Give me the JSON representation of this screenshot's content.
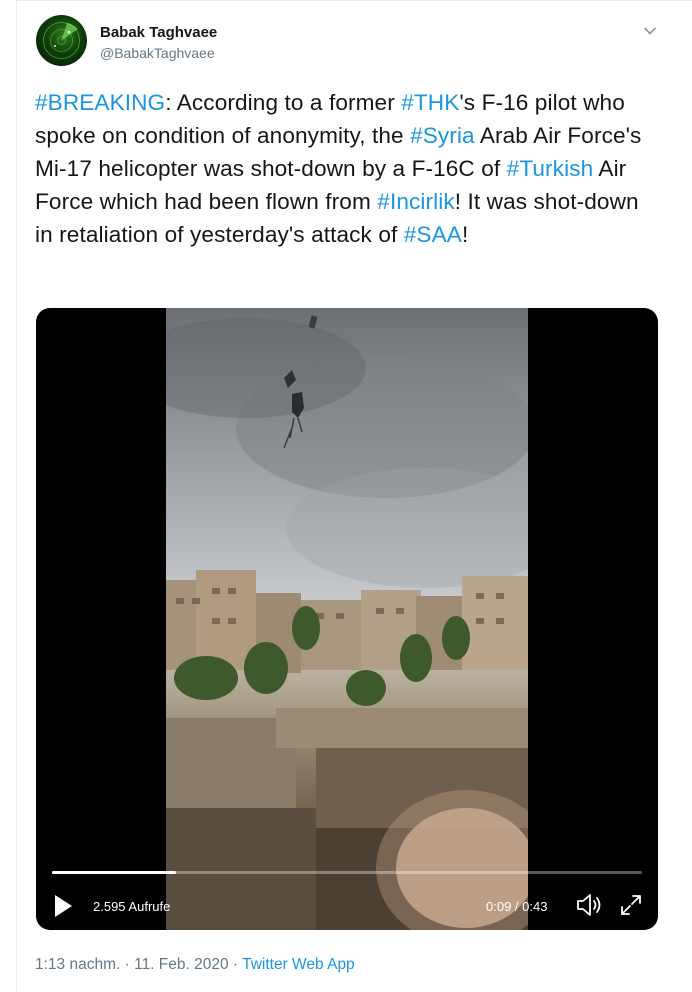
{
  "author": {
    "name": "Babak Taghvaee",
    "handle": "@BabakTaghvaee"
  },
  "tweet": {
    "segments": [
      {
        "text": "#BREAKING",
        "tag": true
      },
      {
        "text": ": According to a former ",
        "tag": false
      },
      {
        "text": "#THK",
        "tag": true
      },
      {
        "text": "'s F-16 pilot who spoke on condition of anonymity, the ",
        "tag": false
      },
      {
        "text": "#Syria",
        "tag": true
      },
      {
        "text": " Arab Air Force's Mi-17 helicopter was shot-down by a F-16C of ",
        "tag": false
      },
      {
        "text": "#Turkish",
        "tag": true
      },
      {
        "text": " Air Force which had been flown from ",
        "tag": false
      },
      {
        "text": "#Incirlik",
        "tag": true
      },
      {
        "text": "! It was shot-down in retaliation of yesterday's attack of ",
        "tag": false
      },
      {
        "text": "#SAA",
        "tag": true
      },
      {
        "text": "!",
        "tag": false
      }
    ]
  },
  "video": {
    "views": "2.595 Aufrufe",
    "time": "0:09 / 0:43",
    "progress": 0.21
  },
  "meta": {
    "time": "1:13 nachm.",
    "separator1": " · ",
    "date": "11. Feb. 2020",
    "separator2": " · ",
    "app": "Twitter Web App"
  },
  "colors": {
    "hashtag": "#1b95e0",
    "secondary": "#657786"
  },
  "icons": {
    "caret": "chevron-down-icon",
    "play": "play-icon",
    "volume": "volume-icon",
    "fullscreen": "fullscreen-icon"
  }
}
